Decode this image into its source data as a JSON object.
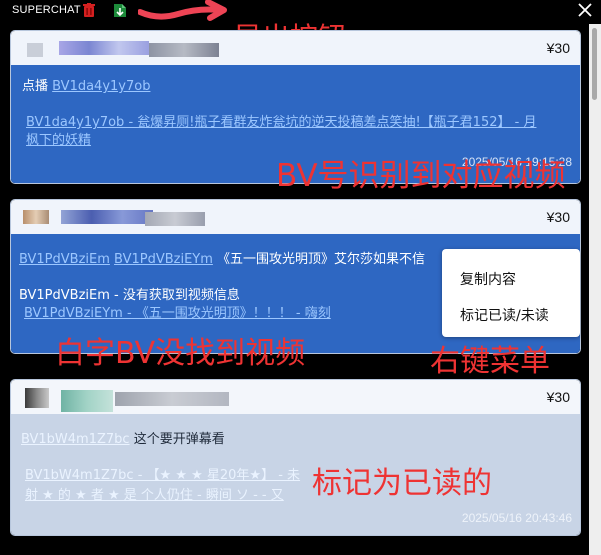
{
  "window": {
    "title": "SUPERCHAT"
  },
  "toolbar": {
    "delete_icon": "trash-icon",
    "export_icon": "export-icon",
    "close_icon": "close-icon"
  },
  "annotations": {
    "export": "导出按钮",
    "bv_detect": "BV号识别到对应视频",
    "white_bv": "白字BV没找到视频",
    "context": "右键菜单",
    "read_mark": "标记为已读的"
  },
  "colors": {
    "accent_blue": "#2e67c2",
    "link": "#9cc7ff",
    "annotation_red": "#ee3333",
    "read_body": "#c8d4e6"
  },
  "cards": [
    {
      "price": "¥30",
      "line1_prefix": "点播",
      "line1_link": "BV1da4y1y7ob",
      "line2_link": "BV1da4y1y7ob - 瓮爆昇厕!瓶子看群友炸瓮坑的逆天投稿差点笑抽!【瓶子君152】 - 月",
      "line3_link": "枫下的妖精",
      "timestamp": "2025/05/16 19:15:28"
    },
    {
      "price": "¥30",
      "line1_link_a": "BV1PdVBziEm",
      "line1_link_b": "BV1PdVBziEYm",
      "line1_text": "《五一围攻光明顶》艾尔莎如果不信",
      "line2_text": "BV1PdVBziEm - 没有获取到视频信息",
      "line3_link": "BV1PdVBziEYm - 《五一围攻光明顶》！！！ - 嗨刻"
    },
    {
      "price": "¥30",
      "line1_link": "BV1bW4m1Z7bc",
      "line1_text": "这个要开弹幕看",
      "line2_link": "BV1bW4m1Z7bc - 【★ ★ ★ 星20年★】 - 未",
      "line3_link": "射 ★ 的 ★ 者 ★ 是 个人仍住 - 瞬间 ソ - - 又",
      "timestamp": "2025/05/16 20:43:46"
    }
  ],
  "context_menu": {
    "items": [
      "复制内容",
      "标记已读/未读"
    ]
  }
}
